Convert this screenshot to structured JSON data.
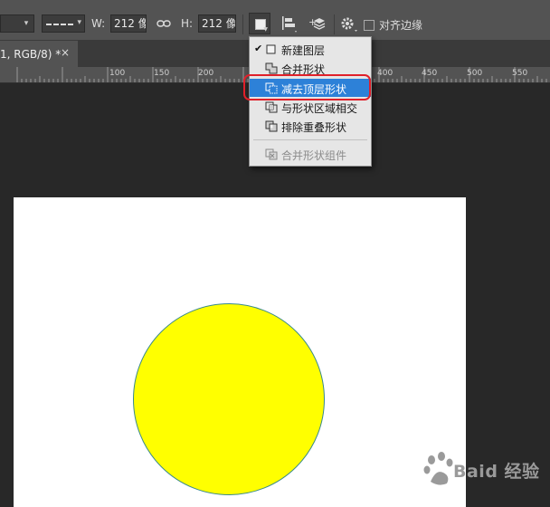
{
  "options_bar": {
    "width_label": "W:",
    "width_value": "212 像",
    "height_label": "H:",
    "height_value": "212 像",
    "align_edges_label": "对齐边缘",
    "icons": [
      "stroke-type-dropdown",
      "link-icon",
      "path-operations-icon",
      "path-alignment-icon",
      "path-arrangement-icon",
      "gear-icon"
    ]
  },
  "tab": {
    "title": "1, RGB/8) *",
    "close": "×"
  },
  "ruler": {
    "labels": [
      "100",
      "150",
      "200",
      "400",
      "450",
      "500",
      "550"
    ]
  },
  "path_ops_menu": {
    "items": [
      {
        "label": "新建图层",
        "checked": true,
        "icon": "new-layer-icon"
      },
      {
        "label": "合并形状",
        "icon": "combine-shapes-icon"
      },
      {
        "label": "减去顶层形状",
        "selected": true,
        "icon": "subtract-front-shape-icon"
      },
      {
        "label": "与形状区域相交",
        "icon": "intersect-shape-areas-icon"
      },
      {
        "label": "排除重叠形状",
        "icon": "exclude-overlapping-shapes-icon"
      },
      {
        "label": "合并形状组件",
        "disabled": true,
        "icon": "merge-shape-components-icon"
      }
    ],
    "selected_color": "#2d81d8",
    "highlight_ring_color": "#e0202a"
  },
  "canvas": {
    "background": "#ffffff",
    "shape_fill": "#ffff00",
    "shape_stroke": "#3a8a8a"
  },
  "watermark": {
    "text": "Baid 经验"
  }
}
